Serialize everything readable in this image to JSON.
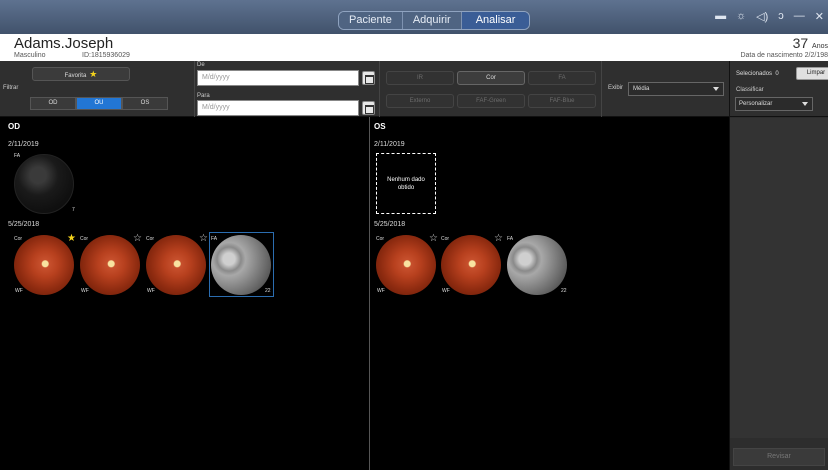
{
  "topbar": {
    "modes": [
      "Paciente",
      "Adquirir",
      "Analisar"
    ],
    "active_mode": "Analisar",
    "icons": [
      "monitor-icon",
      "brightness-icon",
      "volume-icon",
      "wrench-icon",
      "minimize-icon",
      "close-icon"
    ]
  },
  "patient": {
    "name": "Adams.Joseph",
    "sex": "Masculino",
    "id": "ID:1815936029",
    "age": "37",
    "age_unit": "Anos",
    "dob": "Data de nascimento  2/2/198"
  },
  "filters": {
    "filter_label": "Filtrar",
    "favorite_label": "Favorita",
    "eyes": [
      "OD",
      "OU",
      "OS"
    ],
    "selected_eye": "OU",
    "from_label": "De",
    "from_placeholder": "M/d/yyyy",
    "to_label": "Para",
    "to_placeholder": "M/d/yyyy"
  },
  "modality": {
    "row1": [
      "IR",
      "Cor",
      "FA"
    ],
    "row2": [
      "Externo",
      "FAF-Green",
      "FAF-Blue"
    ],
    "active": "Cor",
    "exibir_label": "Exibir",
    "exibir_value": "Média"
  },
  "sidebar": {
    "selected_label": "Selecionados",
    "selected_count": "0",
    "clear_label": "Limpar",
    "sort_label": "Classificar",
    "sort_value": "Personalizar",
    "review_label": "Revisar"
  },
  "od": {
    "title": "OD",
    "groups": [
      {
        "date": "2/11/2019",
        "thumbs": [
          {
            "cap": "FA",
            "num": "7",
            "type": "fa-dark"
          }
        ]
      },
      {
        "date": "5/25/2018",
        "thumbs": [
          {
            "cap": "Cor",
            "corner": "WF",
            "fav": "filled",
            "type": "color"
          },
          {
            "cap": "Cor",
            "corner": "WF",
            "fav": "empty",
            "type": "color"
          },
          {
            "cap": "Cor",
            "corner": "WF",
            "fav": "empty",
            "type": "color"
          },
          {
            "cap": "FA",
            "num": "22",
            "type": "fa"
          }
        ]
      }
    ]
  },
  "os": {
    "title": "OS",
    "groups": [
      {
        "date": "2/11/2019",
        "nodata": "Nenhum dado obtido"
      },
      {
        "date": "5/25/2018",
        "thumbs": [
          {
            "cap": "Cor",
            "corner": "WF",
            "fav": "empty",
            "type": "color"
          },
          {
            "cap": "Cor",
            "corner": "WF",
            "fav": "empty",
            "type": "color"
          },
          {
            "cap": "FA",
            "num": "22",
            "type": "fa"
          }
        ]
      }
    ]
  }
}
